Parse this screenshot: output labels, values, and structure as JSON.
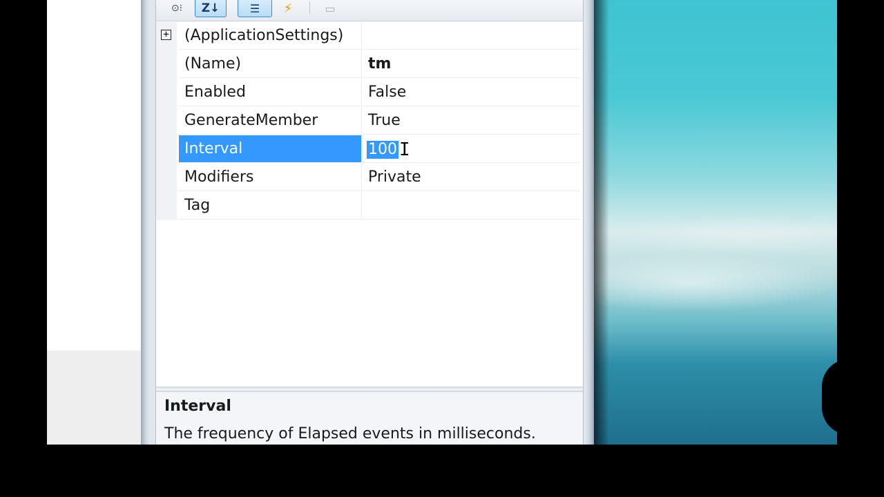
{
  "toolbar": {
    "categorized_icon": "categorized-icon",
    "alphabetical_icon": "alphabetical-icon",
    "alphabetical_glyph": "Z↓",
    "properties_icon": "properties-icon",
    "events_icon": "events-icon",
    "property_pages_icon": "property-pages-icon"
  },
  "properties": {
    "rows": [
      {
        "name": "(ApplicationSettings)",
        "value": "",
        "expandable": true
      },
      {
        "name": "(Name)",
        "value": "tm",
        "bold_value": true
      },
      {
        "name": "Enabled",
        "value": "False"
      },
      {
        "name": "GenerateMember",
        "value": "True"
      },
      {
        "name": "Interval",
        "value": "100",
        "selected": true
      },
      {
        "name": "Modifiers",
        "value": "Private"
      },
      {
        "name": "Tag",
        "value": ""
      }
    ],
    "expander_symbol": "+"
  },
  "description": {
    "title": "Interval",
    "text": "The frequency of Elapsed events in milliseconds."
  },
  "colors": {
    "selection": "#3399ff",
    "toolbar_active": "#b8dcf6"
  }
}
